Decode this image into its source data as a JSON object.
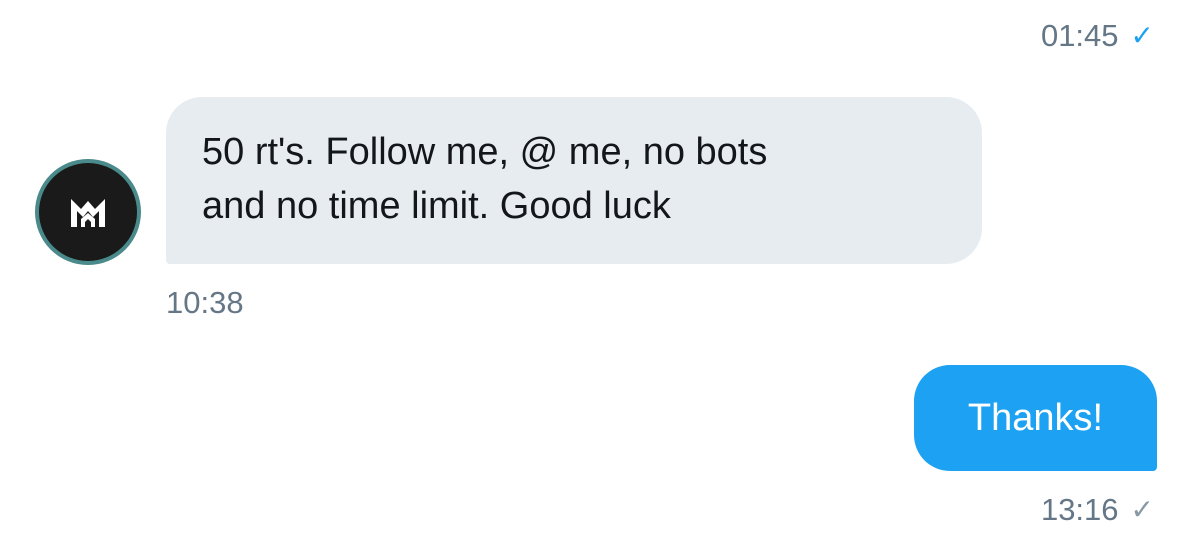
{
  "messages": [
    {
      "direction": "outgoing",
      "timestamp": "01:45",
      "status_icon": "checkmark-icon",
      "status_color": "#1da1f2"
    },
    {
      "direction": "incoming",
      "avatar_icon": "m-logo-icon",
      "text": "50 rt's. Follow me, @ me, no bots\nand no time limit. Good luck",
      "timestamp": "10:38",
      "bubble_color": "#e6ecf0"
    },
    {
      "direction": "outgoing",
      "text": "Thanks!",
      "timestamp": "13:16",
      "status_icon": "checkmark-icon",
      "status_color": "#8899a6",
      "bubble_color": "#1da1f2"
    }
  ],
  "glyphs": {
    "check": "✓"
  }
}
